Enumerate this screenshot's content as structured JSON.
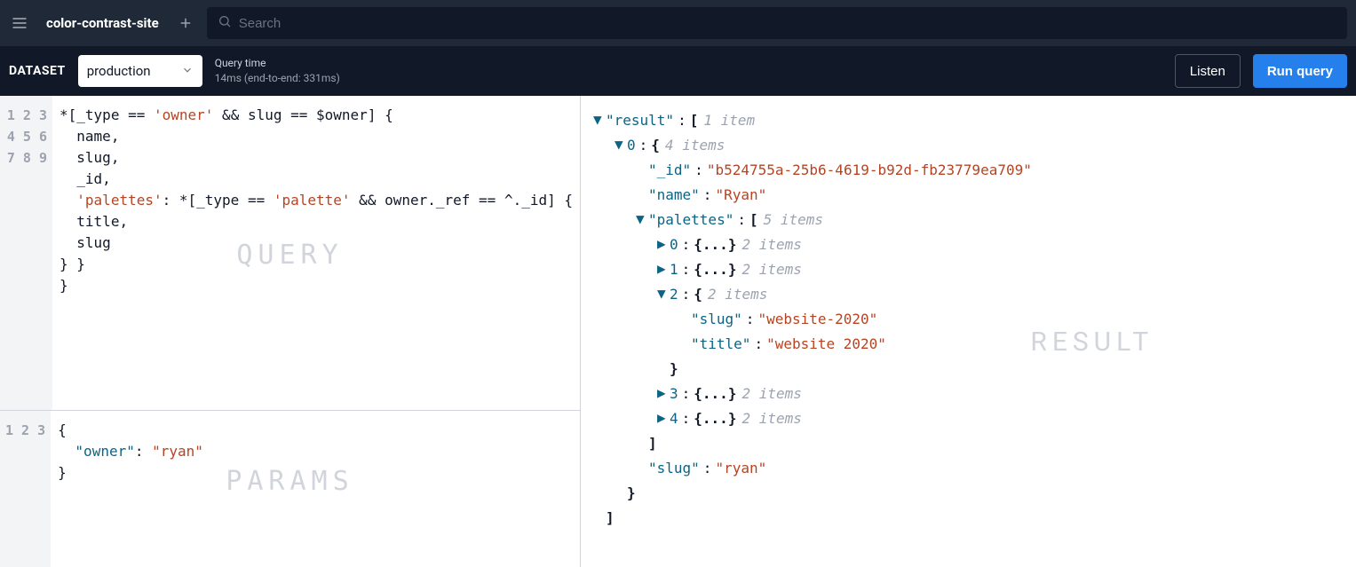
{
  "header": {
    "project_name": "color-contrast-site",
    "search_placeholder": "Search"
  },
  "controls": {
    "dataset_label": "DATASET",
    "dataset_value": "production",
    "query_time_label": "Query time",
    "query_time_detail": "14ms (end-to-end: 331ms)",
    "listen_label": "Listen",
    "run_label": "Run query"
  },
  "watermarks": {
    "query": "QUERY",
    "params": "PARAMS",
    "result": "RESULT"
  },
  "query_lines": [
    "*[_type == 'owner' && slug == $owner] {",
    "  name,",
    "  slug,",
    "  _id,",
    "  'palettes': *[_type == 'palette' && owner._ref == ^._id] {",
    "  title,",
    "  slug",
    "} }",
    "}"
  ],
  "params_lines": [
    "{",
    "  \"owner\": \"ryan\"",
    "}"
  ],
  "result": {
    "root_key": "result",
    "root_hint": "1 item",
    "item0": {
      "index": "0",
      "hint": "4 items",
      "_id_key": "_id",
      "_id_val": "b524755a-25b6-4619-b92d-fb23779ea709",
      "name_key": "name",
      "name_val": "Ryan",
      "palettes_key": "palettes",
      "palettes_hint": "5 items",
      "palettes": [
        {
          "idx": "0",
          "hint": "2 items",
          "expanded": false
        },
        {
          "idx": "1",
          "hint": "2 items",
          "expanded": false
        },
        {
          "idx": "2",
          "hint": "2 items",
          "expanded": true,
          "slug_key": "slug",
          "slug_val": "website-2020",
          "title_key": "title",
          "title_val": "website 2020"
        },
        {
          "idx": "3",
          "hint": "2 items",
          "expanded": false
        },
        {
          "idx": "4",
          "hint": "2 items",
          "expanded": false
        }
      ],
      "slug_key": "slug",
      "slug_val": "ryan"
    }
  }
}
